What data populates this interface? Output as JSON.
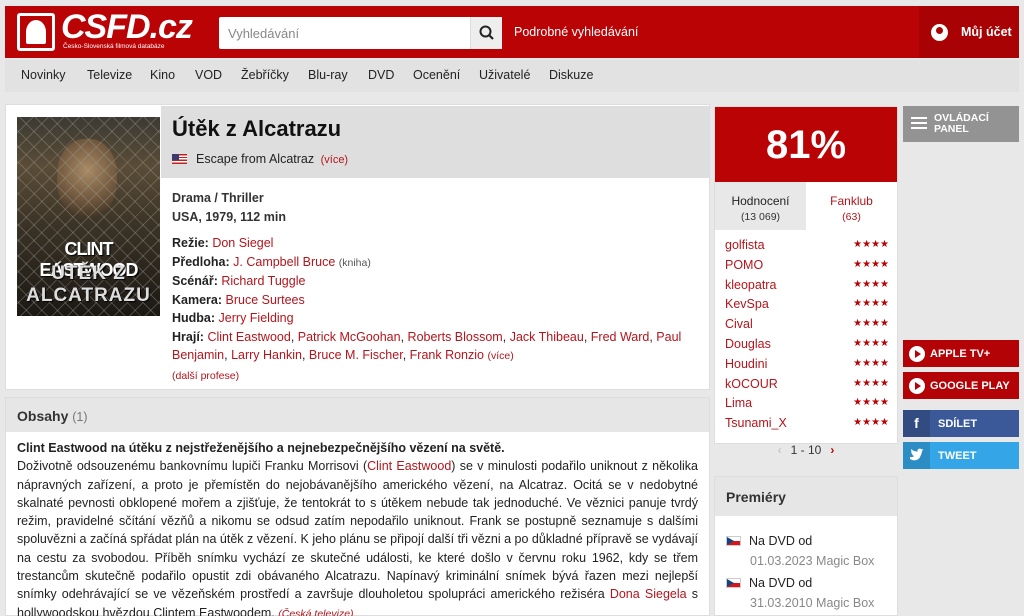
{
  "header": {
    "logo_text": "CSFD.cz",
    "logo_tagline": "Česko-Slovenská filmová databáze",
    "search_placeholder": "Vyhledávání",
    "advanced_search": "Podrobné vyhledávání",
    "account": "Můj účet"
  },
  "nav": [
    "Novinky",
    "Televize",
    "Kino",
    "VOD",
    "Žebříčky",
    "Blu-ray",
    "DVD",
    "Ocenění",
    "Uživatelé",
    "Diskuze"
  ],
  "film": {
    "title": "Útěk z Alcatrazu",
    "original_title": "Escape from Alcatraz",
    "more": "(více)",
    "poster_line1": "CLINT EASTWOOD",
    "poster_line2": "ÚTĚK Z",
    "poster_line3": "ALCATRAZU",
    "genre": "Drama / Thriller",
    "origin": "USA, 1979, 112 min",
    "director_label": "Režie:",
    "director": "Don Siegel",
    "source_label": "Předloha:",
    "source": "J. Campbell Bruce",
    "source_note": "(kniha)",
    "writer_label": "Scénář:",
    "writer": "Richard Tuggle",
    "camera_label": "Kamera:",
    "camera": "Bruce Surtees",
    "music_label": "Hudba:",
    "music": "Jerry Fielding",
    "cast_label": "Hrají:",
    "cast": [
      "Clint Eastwood",
      "Patrick McGoohan",
      "Roberts Blossom",
      "Jack Thibeau",
      "Fred Ward",
      "Paul Benjamin",
      "Larry Hankin",
      "Bruce M. Fischer",
      "Frank Ronzio"
    ],
    "cast_more": "(více)",
    "more_professions": "(další profese)"
  },
  "plot": {
    "heading": "Obsahy",
    "count": "(1)",
    "lead": "Clint Eastwood na útěku z nejstřeženějšího a nejnebezpečnějšího vězení na světě.",
    "part1": "Doživotně odsouzenému bankovnímu lupiči Franku Morrisovi (",
    "actor_link": "Clint Eastwood",
    "part2": ") se v minulosti podařilo uniknout z několika nápravných zařízení, a proto je přemístěn do nejobávanějšího amerického vězení, na Alcatraz. Ocitá se v nedobytné skalnaté pevnosti obklopené mořem a zjišťuje, že tentokrát to s útěkem nebude tak jednoduché. Ve věznici panuje tvrdý režim, pravidelné sčítání vězňů a nikomu se odsud zatím nepodařilo uniknout. Frank se postupně seznamuje s dalšími spoluvězni a začíná spřádat plán na útěk z vězení. K jeho plánu se připojí další tři vězni a po důkladné přípravě se vydávají na cestu za svobodou. Příběh snímku vychází ze skutečné události, ke které došlo v červnu roku 1962, kdy se třem trestancům skutečně podařilo opustit zdi obávaného Alcatrazu. Napínavý kriminální snímek bývá řazen mezi nejlepší snímky odehrávající se ve vězeňském prostředí a završuje dlouholetou spolupráci amerického režiséra ",
    "director_link": "Dona Siegela",
    "part3": " s hollywoodskou hvězdou Clintem Eastwoodem. ",
    "source": "(Česká televize)"
  },
  "rating": {
    "score": "81%",
    "tab_ratings": "Hodnocení",
    "tab_ratings_count": "(13 069)",
    "tab_fanclub": "Fanklub",
    "tab_fanclub_count": "(63)",
    "stars": "★★★★",
    "users": [
      "golfista",
      "POMO",
      "kleopatra",
      "KevSpa",
      "Cival",
      "Douglas",
      "Houdini",
      "kOCOUR",
      "Lima",
      "Tsunami_X"
    ],
    "pager": "1 - 10",
    "prev": "‹",
    "next": "›"
  },
  "premieres": {
    "heading": "Premiéry",
    "entries": [
      {
        "label": "Na DVD od",
        "date": "01.03.2023 Magic Box"
      },
      {
        "label": "Na DVD od",
        "date": "31.03.2010 Magic Box"
      }
    ]
  },
  "side": {
    "panel": "OVLÁDACÍ PANEL",
    "apple": "APPLE TV+",
    "google": "GOOGLE PLAY",
    "share": "SDÍLET",
    "tweet": "TWEET"
  }
}
